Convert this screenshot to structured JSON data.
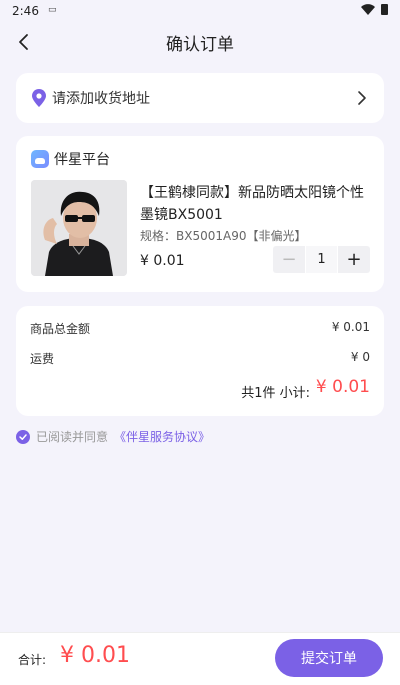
{
  "status_bar": {
    "time": "2:46",
    "sim_label": "SIM"
  },
  "header": {
    "title": "确认订单"
  },
  "address": {
    "placeholder": "请添加收货地址"
  },
  "shop": {
    "name": "伴星平台",
    "product": {
      "title": "【王鹤棣同款】新品防晒太阳镜个性墨镜BX5001",
      "spec": "规格：BX5001A90【非偏光】",
      "price": "¥ 0.01",
      "quantity": "1",
      "minus": "−",
      "plus": "+"
    }
  },
  "summary": {
    "goods_total_label": "商品总金额",
    "goods_total_value": "¥ 0.01",
    "shipping_label": "运费",
    "shipping_value": "¥ 0",
    "subtotal_label": "共1件 小计:",
    "subtotal_value": "¥ 0.01"
  },
  "agreement": {
    "text": "已阅读并同意",
    "link": "《伴星服务协议》"
  },
  "footer": {
    "total_label": "合计:",
    "total_value": "¥ 0.01",
    "submit_label": "提交订单"
  },
  "colors": {
    "accent": "#7b61e6",
    "price_red": "#ff4d4f",
    "background": "#f4f3fb"
  }
}
